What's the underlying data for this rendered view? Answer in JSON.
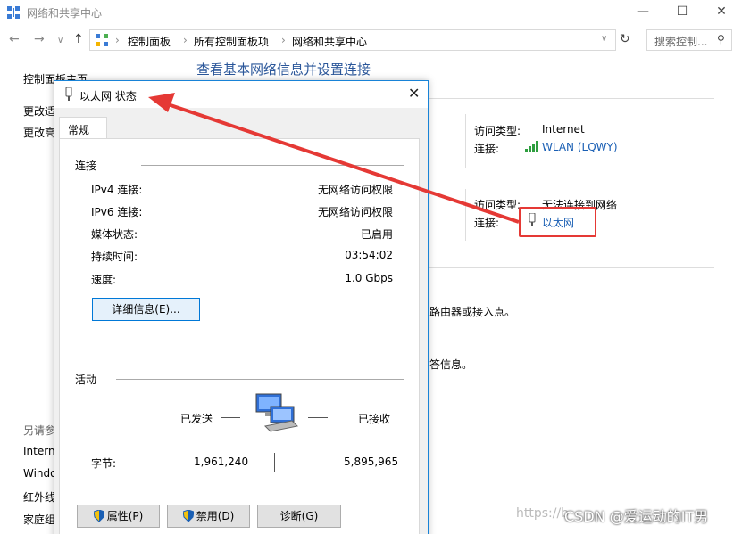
{
  "window": {
    "title": "网络和共享中心"
  },
  "address": {
    "crumbs": [
      "控制面板",
      "所有控制面板项",
      "网络和共享中心"
    ],
    "search_placeholder": "搜索控制..."
  },
  "sidebar": {
    "home": "控制面板主页",
    "items": [
      "更改适",
      "更改高"
    ],
    "see_also_label": "另请参",
    "see_also": [
      "Intern",
      "Windo",
      "红外线",
      "家庭组"
    ]
  },
  "main": {
    "title": "查看基本网络信息并设置连接",
    "net1": {
      "access_label": "访问类型:",
      "access_value": "Internet",
      "conn_label": "连接:",
      "conn_value": "WLAN (LQWY)"
    },
    "net2": {
      "access_label": "访问类型:",
      "access_value": "无法连接到网络",
      "conn_label": "连接:",
      "conn_value": "以太网"
    },
    "frag1": "路由器或接入点。",
    "frag2": "答信息。"
  },
  "dialog": {
    "title": "以太网 状态",
    "tab": "常规",
    "connection_header": "连接",
    "rows": [
      {
        "label": "IPv4 连接:",
        "value": "无网络访问权限"
      },
      {
        "label": "IPv6 连接:",
        "value": "无网络访问权限"
      },
      {
        "label": "媒体状态:",
        "value": "已启用"
      },
      {
        "label": "持续时间:",
        "value": "03:54:02"
      },
      {
        "label": "速度:",
        "value": "1.0 Gbps"
      }
    ],
    "details_button": "详细信息(E)...",
    "activity_header": "活动",
    "sent_label": "已发送",
    "received_label": "已接收",
    "bytes_label": "字节:",
    "bytes_sent": "1,961,240",
    "bytes_received": "5,895,965",
    "buttons": {
      "properties": "属性(P)",
      "disable": "禁用(D)",
      "diagnose": "诊断(G)"
    }
  },
  "watermark": {
    "url": "https://b",
    "text": "CSDN @爱运动的IT男"
  },
  "colors": {
    "accent": "#1883d7",
    "link": "#1a5fb4",
    "annotation": "#e53935"
  }
}
